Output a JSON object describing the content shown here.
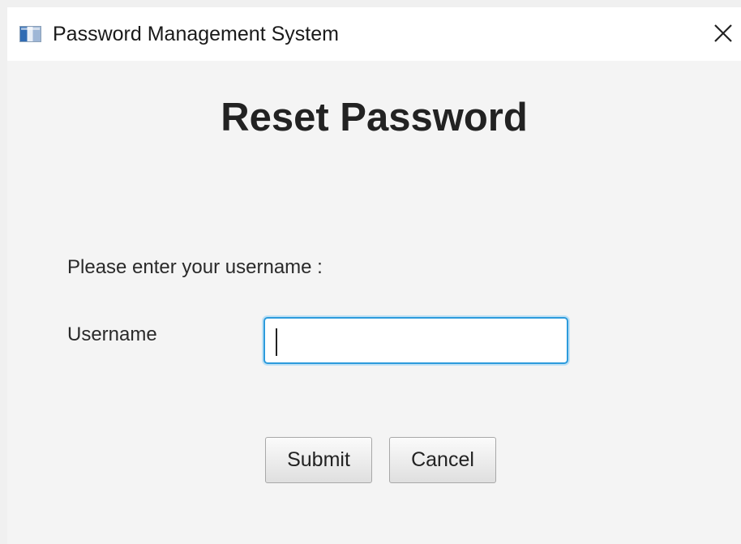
{
  "window": {
    "title": "Password Management System",
    "icon": "app-window-icon",
    "close_icon": "close-icon"
  },
  "form": {
    "heading": "Reset Password",
    "prompt": "Please enter your username :",
    "username_label": "Username",
    "username_value": "",
    "focus_color": "#2d9bdc"
  },
  "buttons": {
    "submit_label": "Submit",
    "cancel_label": "Cancel"
  }
}
